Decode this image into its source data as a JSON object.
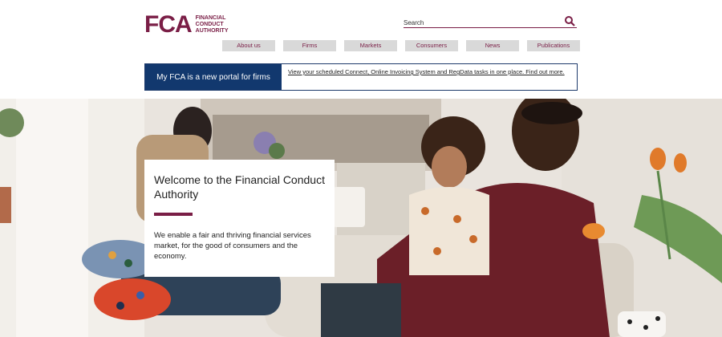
{
  "header": {
    "logo_mark": "FCA",
    "logo_lines": [
      "FINANCIAL",
      "CONDUCT",
      "AUTHORITY"
    ],
    "search_placeholder": "Search",
    "search_icon": "search-icon",
    "brand_color": "#7a1e46"
  },
  "nav": {
    "items": [
      {
        "label": "About us"
      },
      {
        "label": "Firms"
      },
      {
        "label": "Markets"
      },
      {
        "label": "Consumers"
      },
      {
        "label": "News"
      },
      {
        "label": "Publications"
      }
    ]
  },
  "banner": {
    "left_text": "My FCA is a new portal for firms",
    "link_text": "View your scheduled Connect, Online Invoicing System and RegData tasks in one place. Find out more.",
    "accent": "#12386e"
  },
  "hero": {
    "title": "Welcome to the Financial Conduct Authority",
    "text": "We enable a fair and thriving financial services market, for the good of consumers and the economy."
  }
}
